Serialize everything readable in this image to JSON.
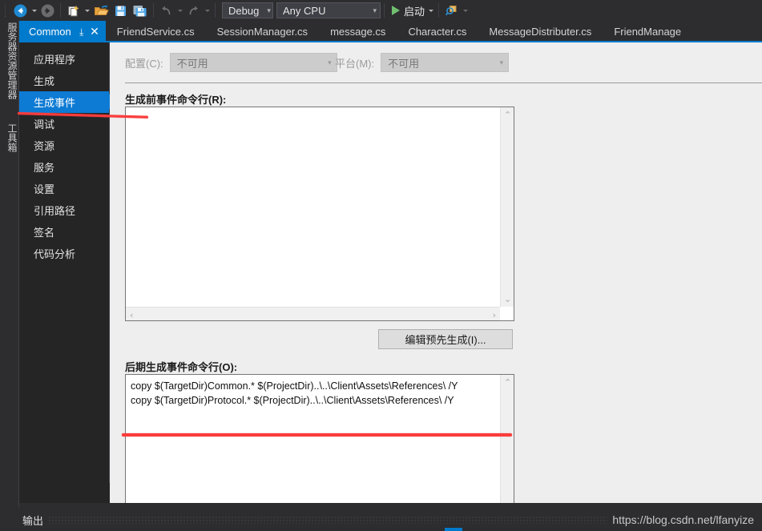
{
  "toolbar": {
    "icons": [
      {
        "name": "navigate-back-icon",
        "glyph": "←"
      },
      {
        "name": "navigate-forward-icon",
        "glyph": "→"
      },
      {
        "name": "new-item-icon",
        "glyph": "▣"
      },
      {
        "name": "open-folder-icon",
        "glyph": "Ὄ1"
      },
      {
        "name": "save-icon",
        "glyph": "Ὃe"
      },
      {
        "name": "save-all-icon",
        "glyph": "὚b"
      },
      {
        "name": "undo-icon",
        "glyph": "↶"
      },
      {
        "name": "redo-icon",
        "glyph": "↷"
      }
    ],
    "configuration_combo": "Debug",
    "platform_combo": "Any CPU",
    "run_label": "启动",
    "find_icon": "search-icon"
  },
  "tabs": [
    {
      "label": "Common",
      "active": true,
      "pin": "⤓",
      "close": "✕"
    },
    {
      "label": "FriendService.cs",
      "active": false
    },
    {
      "label": "SessionManager.cs",
      "active": false
    },
    {
      "label": "message.cs",
      "active": false
    },
    {
      "label": "Character.cs",
      "active": false
    },
    {
      "label": "MessageDistributer.cs",
      "active": false
    },
    {
      "label": "FriendManage",
      "active": false
    }
  ],
  "vertical_dock": {
    "server_explorer": "服务器资源管理器",
    "toolbox": "工具箱"
  },
  "categories": [
    {
      "label": "应用程序",
      "selected": false
    },
    {
      "label": "生成",
      "selected": false
    },
    {
      "label": "生成事件",
      "selected": true
    },
    {
      "label": "调试",
      "selected": false
    },
    {
      "label": "资源",
      "selected": false
    },
    {
      "label": "服务",
      "selected": false
    },
    {
      "label": "设置",
      "selected": false
    },
    {
      "label": "引用路径",
      "selected": false
    },
    {
      "label": "签名",
      "selected": false
    },
    {
      "label": "代码分析",
      "selected": false
    }
  ],
  "content": {
    "configuration_label": "配置(C):",
    "configuration_value": "不可用",
    "platform_label": "平台(M):",
    "platform_value": "不可用",
    "pre_build_label": "生成前事件命令行(R):",
    "pre_build_value": "",
    "post_build_label": "后期生成事件命令行(O):",
    "post_build_lines": [
      "copy $(TargetDir)Common.* $(ProjectDir)..\\..\\Client\\Assets\\References\\ /Y",
      "copy $(TargetDir)Protocol.* $(ProjectDir)..\\..\\Client\\Assets\\References\\ /Y"
    ],
    "edit_prebuild_button": "编辑预先生成(I)...",
    "scroll_up_icon": "⌃",
    "scroll_down_icon": "⌄",
    "scroll_left_icon": "‹",
    "scroll_right_icon": "›"
  },
  "status": {
    "output_label": "输出",
    "watermark": "https://blog.csdn.net/lfanyize"
  },
  "colors": {
    "accent": "#007acc",
    "selection": "#0d7bd4",
    "chrome_dark": "#2d2d30",
    "panel_dark": "#252526",
    "content_bg": "#eeeeee",
    "annotation_red": "#fa3c3c"
  }
}
